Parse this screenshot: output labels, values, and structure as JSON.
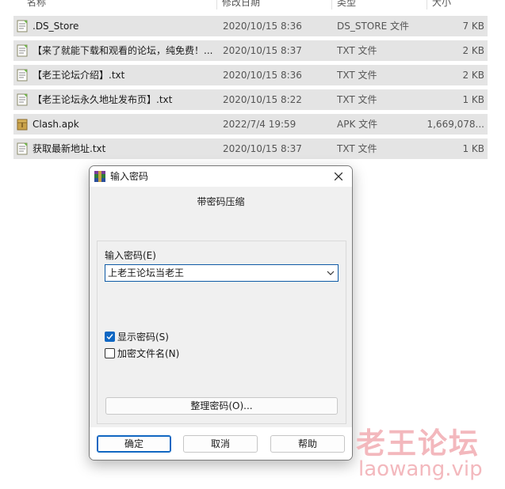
{
  "columns": {
    "name": "名称",
    "date": "修改日期",
    "type": "类型",
    "size": "大小"
  },
  "files": [
    {
      "name": ".DS_Store",
      "date": "2020/10/15 8:36",
      "type": "DS_STORE 文件",
      "size": "7 KB",
      "icon": "text-file-icon"
    },
    {
      "name": "【来了就能下载和观看的论坛，纯免费！...",
      "date": "2020/10/15 8:37",
      "type": "TXT 文件",
      "size": "2 KB",
      "icon": "text-file-icon"
    },
    {
      "name": "【老王论坛介绍】.txt",
      "date": "2020/10/15 8:36",
      "type": "TXT 文件",
      "size": "2 KB",
      "icon": "text-file-icon"
    },
    {
      "name": "【老王论坛永久地址发布页】.txt",
      "date": "2020/10/15 8:22",
      "type": "TXT 文件",
      "size": "1 KB",
      "icon": "text-file-icon"
    },
    {
      "name": "Clash.apk",
      "date": "2022/7/4 19:59",
      "type": "APK 文件",
      "size": "1,669,078...",
      "icon": "archive-file-icon"
    },
    {
      "name": "获取最新地址.txt",
      "date": "2020/10/15 8:37",
      "type": "TXT 文件",
      "size": "1 KB",
      "icon": "text-file-icon"
    }
  ],
  "dialog": {
    "title": "输入密码",
    "heading": "带密码压缩",
    "password_label": "输入密码(E)",
    "password_value": "上老王论坛当老王",
    "show_password": {
      "label": "显示密码(S)",
      "checked": true
    },
    "encrypt_names": {
      "label": "加密文件名(N)",
      "checked": false
    },
    "organize_button": "整理密码(O)...",
    "ok_button": "确定",
    "cancel_button": "取消",
    "help_button": "帮助"
  },
  "watermark": {
    "line1": "老王论坛",
    "line2": "laowang.vip"
  },
  "colors": {
    "accent": "#0f67c3",
    "selection_row": "#e4e4e4",
    "watermark": "#f3b8bd"
  }
}
